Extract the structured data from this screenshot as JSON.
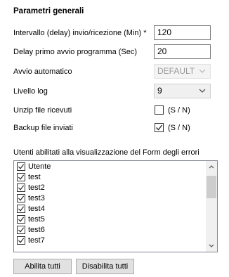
{
  "section": {
    "title": "Parametri generali"
  },
  "fields": {
    "interval": {
      "label": "Intervallo (delay) invio/ricezione (Min) *",
      "value": "120"
    },
    "startup_delay": {
      "label": "Delay primo avvio programma (Sec)",
      "value": "20"
    },
    "auto_start": {
      "label": "Avvio automatico",
      "value": "DEFAULT",
      "enabled": false
    },
    "log_level": {
      "label": "Livello log",
      "value": "9"
    },
    "unzip": {
      "label": "Unzip file ricevuti",
      "checked": false,
      "caption": "(S / N)"
    },
    "backup": {
      "label": "Backup file inviati",
      "checked": true,
      "caption": "(S / N)"
    }
  },
  "users": {
    "label": "Utenti abilitati alla visualizzazione del Form degli errori",
    "items": [
      {
        "name": "Utente",
        "checked": true
      },
      {
        "name": "test",
        "checked": true
      },
      {
        "name": "test2",
        "checked": true
      },
      {
        "name": "test3",
        "checked": true
      },
      {
        "name": "test4",
        "checked": true
      },
      {
        "name": "test5",
        "checked": true
      },
      {
        "name": "test6",
        "checked": true
      },
      {
        "name": "test7",
        "checked": true
      }
    ]
  },
  "buttons": {
    "enable_all": "Abilita tutti",
    "disable_all": "Disabilita tutti"
  }
}
